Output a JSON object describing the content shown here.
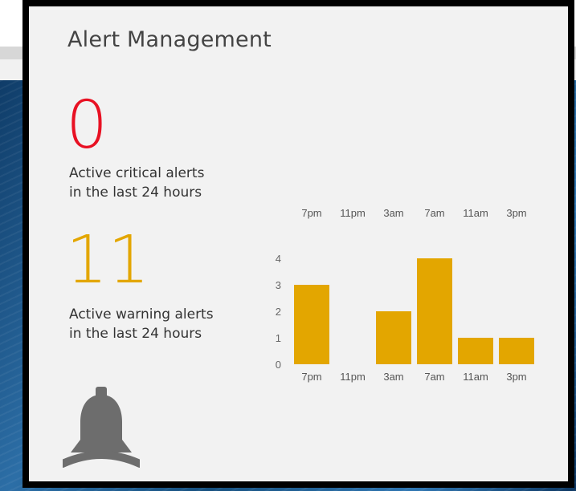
{
  "panel": {
    "title": "Alert Management",
    "critical": {
      "count": "0",
      "line1": "Active critical alerts",
      "line2": "in the last 24 hours"
    },
    "warning": {
      "count": "11",
      "line1": "Active warning alerts",
      "line2": "in the last 24 hours"
    }
  },
  "icons": {
    "bell": "bell-icon"
  },
  "colors": {
    "critical": "#e81123",
    "warning": "#e3a600",
    "bar": "#e3a600",
    "icon": "#6d6d6d"
  },
  "chart_data": {
    "type": "bar",
    "categories": [
      "7pm",
      "11pm",
      "3am",
      "7am",
      "11am",
      "3pm"
    ],
    "values": [
      3,
      0,
      2,
      4,
      1,
      1
    ],
    "ylim": [
      0,
      4
    ],
    "yticks": [
      0,
      1,
      2,
      3,
      4
    ],
    "top_labels": [
      "7pm",
      "11pm",
      "3am",
      "7am",
      "11am",
      "3pm"
    ],
    "title": "",
    "xlabel": "",
    "ylabel": "",
    "grid": false
  }
}
